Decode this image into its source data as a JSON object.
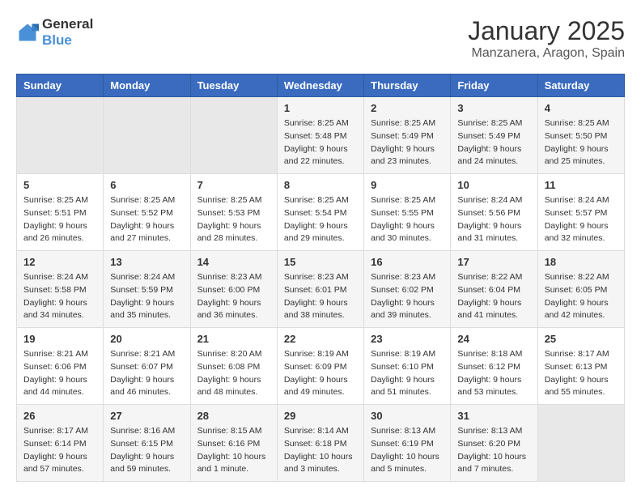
{
  "logo": {
    "line1": "General",
    "line2": "Blue"
  },
  "title": "January 2025",
  "subtitle": "Manzanera, Aragon, Spain",
  "days_of_week": [
    "Sunday",
    "Monday",
    "Tuesday",
    "Wednesday",
    "Thursday",
    "Friday",
    "Saturday"
  ],
  "weeks": [
    [
      {
        "day": "",
        "sunrise": "",
        "sunset": "",
        "daylight": ""
      },
      {
        "day": "",
        "sunrise": "",
        "sunset": "",
        "daylight": ""
      },
      {
        "day": "",
        "sunrise": "",
        "sunset": "",
        "daylight": ""
      },
      {
        "day": "1",
        "sunrise": "Sunrise: 8:25 AM",
        "sunset": "Sunset: 5:48 PM",
        "daylight": "Daylight: 9 hours and 22 minutes."
      },
      {
        "day": "2",
        "sunrise": "Sunrise: 8:25 AM",
        "sunset": "Sunset: 5:49 PM",
        "daylight": "Daylight: 9 hours and 23 minutes."
      },
      {
        "day": "3",
        "sunrise": "Sunrise: 8:25 AM",
        "sunset": "Sunset: 5:49 PM",
        "daylight": "Daylight: 9 hours and 24 minutes."
      },
      {
        "day": "4",
        "sunrise": "Sunrise: 8:25 AM",
        "sunset": "Sunset: 5:50 PM",
        "daylight": "Daylight: 9 hours and 25 minutes."
      }
    ],
    [
      {
        "day": "5",
        "sunrise": "Sunrise: 8:25 AM",
        "sunset": "Sunset: 5:51 PM",
        "daylight": "Daylight: 9 hours and 26 minutes."
      },
      {
        "day": "6",
        "sunrise": "Sunrise: 8:25 AM",
        "sunset": "Sunset: 5:52 PM",
        "daylight": "Daylight: 9 hours and 27 minutes."
      },
      {
        "day": "7",
        "sunrise": "Sunrise: 8:25 AM",
        "sunset": "Sunset: 5:53 PM",
        "daylight": "Daylight: 9 hours and 28 minutes."
      },
      {
        "day": "8",
        "sunrise": "Sunrise: 8:25 AM",
        "sunset": "Sunset: 5:54 PM",
        "daylight": "Daylight: 9 hours and 29 minutes."
      },
      {
        "day": "9",
        "sunrise": "Sunrise: 8:25 AM",
        "sunset": "Sunset: 5:55 PM",
        "daylight": "Daylight: 9 hours and 30 minutes."
      },
      {
        "day": "10",
        "sunrise": "Sunrise: 8:24 AM",
        "sunset": "Sunset: 5:56 PM",
        "daylight": "Daylight: 9 hours and 31 minutes."
      },
      {
        "day": "11",
        "sunrise": "Sunrise: 8:24 AM",
        "sunset": "Sunset: 5:57 PM",
        "daylight": "Daylight: 9 hours and 32 minutes."
      }
    ],
    [
      {
        "day": "12",
        "sunrise": "Sunrise: 8:24 AM",
        "sunset": "Sunset: 5:58 PM",
        "daylight": "Daylight: 9 hours and 34 minutes."
      },
      {
        "day": "13",
        "sunrise": "Sunrise: 8:24 AM",
        "sunset": "Sunset: 5:59 PM",
        "daylight": "Daylight: 9 hours and 35 minutes."
      },
      {
        "day": "14",
        "sunrise": "Sunrise: 8:23 AM",
        "sunset": "Sunset: 6:00 PM",
        "daylight": "Daylight: 9 hours and 36 minutes."
      },
      {
        "day": "15",
        "sunrise": "Sunrise: 8:23 AM",
        "sunset": "Sunset: 6:01 PM",
        "daylight": "Daylight: 9 hours and 38 minutes."
      },
      {
        "day": "16",
        "sunrise": "Sunrise: 8:23 AM",
        "sunset": "Sunset: 6:02 PM",
        "daylight": "Daylight: 9 hours and 39 minutes."
      },
      {
        "day": "17",
        "sunrise": "Sunrise: 8:22 AM",
        "sunset": "Sunset: 6:04 PM",
        "daylight": "Daylight: 9 hours and 41 minutes."
      },
      {
        "day": "18",
        "sunrise": "Sunrise: 8:22 AM",
        "sunset": "Sunset: 6:05 PM",
        "daylight": "Daylight: 9 hours and 42 minutes."
      }
    ],
    [
      {
        "day": "19",
        "sunrise": "Sunrise: 8:21 AM",
        "sunset": "Sunset: 6:06 PM",
        "daylight": "Daylight: 9 hours and 44 minutes."
      },
      {
        "day": "20",
        "sunrise": "Sunrise: 8:21 AM",
        "sunset": "Sunset: 6:07 PM",
        "daylight": "Daylight: 9 hours and 46 minutes."
      },
      {
        "day": "21",
        "sunrise": "Sunrise: 8:20 AM",
        "sunset": "Sunset: 6:08 PM",
        "daylight": "Daylight: 9 hours and 48 minutes."
      },
      {
        "day": "22",
        "sunrise": "Sunrise: 8:19 AM",
        "sunset": "Sunset: 6:09 PM",
        "daylight": "Daylight: 9 hours and 49 minutes."
      },
      {
        "day": "23",
        "sunrise": "Sunrise: 8:19 AM",
        "sunset": "Sunset: 6:10 PM",
        "daylight": "Daylight: 9 hours and 51 minutes."
      },
      {
        "day": "24",
        "sunrise": "Sunrise: 8:18 AM",
        "sunset": "Sunset: 6:12 PM",
        "daylight": "Daylight: 9 hours and 53 minutes."
      },
      {
        "day": "25",
        "sunrise": "Sunrise: 8:17 AM",
        "sunset": "Sunset: 6:13 PM",
        "daylight": "Daylight: 9 hours and 55 minutes."
      }
    ],
    [
      {
        "day": "26",
        "sunrise": "Sunrise: 8:17 AM",
        "sunset": "Sunset: 6:14 PM",
        "daylight": "Daylight: 9 hours and 57 minutes."
      },
      {
        "day": "27",
        "sunrise": "Sunrise: 8:16 AM",
        "sunset": "Sunset: 6:15 PM",
        "daylight": "Daylight: 9 hours and 59 minutes."
      },
      {
        "day": "28",
        "sunrise": "Sunrise: 8:15 AM",
        "sunset": "Sunset: 6:16 PM",
        "daylight": "Daylight: 10 hours and 1 minute."
      },
      {
        "day": "29",
        "sunrise": "Sunrise: 8:14 AM",
        "sunset": "Sunset: 6:18 PM",
        "daylight": "Daylight: 10 hours and 3 minutes."
      },
      {
        "day": "30",
        "sunrise": "Sunrise: 8:13 AM",
        "sunset": "Sunset: 6:19 PM",
        "daylight": "Daylight: 10 hours and 5 minutes."
      },
      {
        "day": "31",
        "sunrise": "Sunrise: 8:13 AM",
        "sunset": "Sunset: 6:20 PM",
        "daylight": "Daylight: 10 hours and 7 minutes."
      },
      {
        "day": "",
        "sunrise": "",
        "sunset": "",
        "daylight": ""
      }
    ]
  ]
}
